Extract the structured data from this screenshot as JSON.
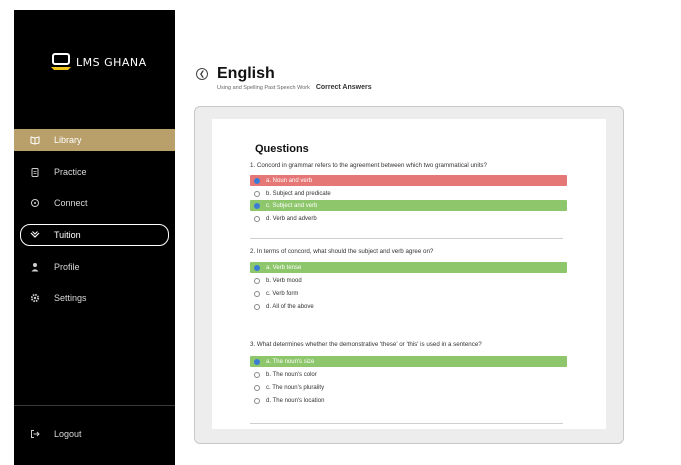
{
  "app": {
    "logo_text": "LMS GHANA",
    "brand_color": "#b9a06b"
  },
  "sidebar": {
    "items": [
      {
        "label": "Library",
        "icon": "book-icon",
        "state": "active"
      },
      {
        "label": "Practice",
        "icon": "clipboard-icon",
        "state": "normal"
      },
      {
        "label": "Connect",
        "icon": "chat-icon",
        "state": "normal"
      },
      {
        "label": "Tuition",
        "icon": "graduation-icon",
        "state": "outlined"
      },
      {
        "label": "Profile",
        "icon": "person-icon",
        "state": "normal"
      },
      {
        "label": "Settings",
        "icon": "gear-icon",
        "state": "normal"
      }
    ],
    "logout_label": "Logout"
  },
  "header": {
    "title": "English",
    "breadcrumb": "Using and Spelling Past Speech Work",
    "mode_label": "Correct Answers"
  },
  "questions_heading": "Questions",
  "questions": [
    {
      "text": "1. Concord in grammar refers to the agreement between which two grammatical units?",
      "options": [
        {
          "label": "a. Noun and verb",
          "state": "wrong"
        },
        {
          "label": "b. Subject and predicate",
          "state": "none"
        },
        {
          "label": "c. Subject and verb",
          "state": "correct"
        },
        {
          "label": "d. Verb and adverb",
          "state": "none"
        }
      ]
    },
    {
      "text": "2. In terms of concord, what should the subject and verb agree on?",
      "options": [
        {
          "label": "a. Verb tense",
          "state": "correct"
        },
        {
          "label": "b. Verb mood",
          "state": "none"
        },
        {
          "label": "c. Verb form",
          "state": "none"
        },
        {
          "label": "d. All of the above",
          "state": "none"
        }
      ]
    },
    {
      "text": "3. What determines whether the demonstrative 'these' or 'this' is used in a sentence?",
      "options": [
        {
          "label": "a. The noun's size",
          "state": "correct"
        },
        {
          "label": "b. The noun's color",
          "state": "none"
        },
        {
          "label": "c. The noun's plurality",
          "state": "none"
        },
        {
          "label": "d. The noun's location",
          "state": "none"
        }
      ]
    }
  ]
}
